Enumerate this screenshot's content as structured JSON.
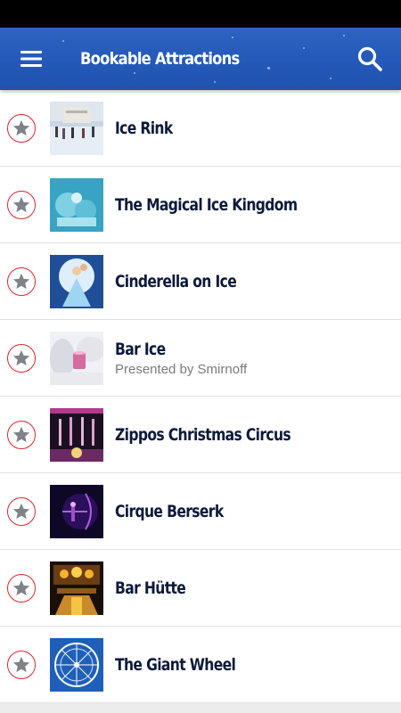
{
  "app_bar": {
    "title": "Bookable Attractions",
    "menu_icon": "menu-icon",
    "search_icon": "search-icon",
    "background_color": "#2459b9"
  },
  "list": {
    "favorite_icon": "star-icon",
    "accent_color": "#d9272e",
    "items": [
      {
        "title": "Ice Rink",
        "subtitle": ""
      },
      {
        "title": "The Magical Ice Kingdom",
        "subtitle": ""
      },
      {
        "title": "Cinderella on Ice",
        "subtitle": ""
      },
      {
        "title": "Bar Ice",
        "subtitle": "Presented by Smirnoff"
      },
      {
        "title": "Zippos Christmas Circus",
        "subtitle": ""
      },
      {
        "title": "Cirque Berserk",
        "subtitle": ""
      },
      {
        "title": "Bar Hütte",
        "subtitle": ""
      },
      {
        "title": "The Giant Wheel",
        "subtitle": ""
      }
    ]
  }
}
